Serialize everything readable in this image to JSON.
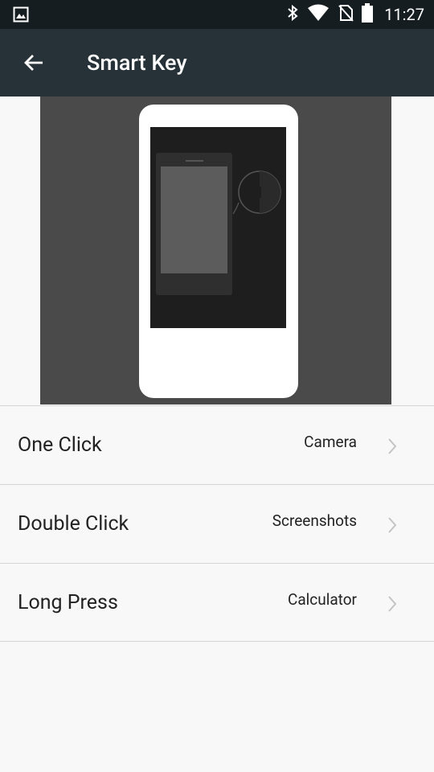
{
  "status_bar": {
    "time": "11:27",
    "icons": [
      "image-notification-icon",
      "bluetooth-icon",
      "wifi-icon",
      "no-sim-icon",
      "battery-icon"
    ]
  },
  "app_bar": {
    "title": "Smart Key",
    "back_icon": "arrow-back-icon"
  },
  "colors": {
    "status_bar": "#151d21",
    "app_bar": "#263238",
    "background": "#f8f8f8",
    "hero": "#4a4a4a"
  },
  "settings": [
    {
      "label": "One Click",
      "value": "Camera"
    },
    {
      "label": "Double Click",
      "value": "Screenshots"
    },
    {
      "label": "Long Press",
      "value": "Calculator"
    }
  ]
}
